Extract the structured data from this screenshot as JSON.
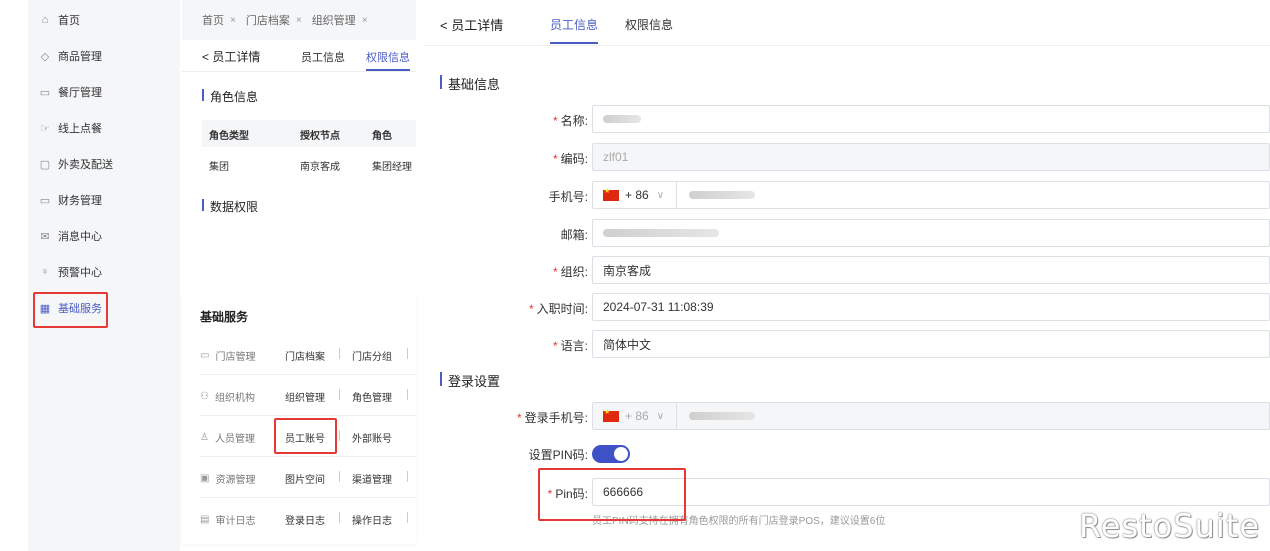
{
  "sidebar": {
    "items": [
      {
        "label": "首页",
        "icon": "home-icon",
        "glyph": "⌂"
      },
      {
        "label": "商品管理",
        "icon": "cube-icon",
        "glyph": "◇"
      },
      {
        "label": "餐厅管理",
        "icon": "store-icon",
        "glyph": "▭"
      },
      {
        "label": "线上点餐",
        "icon": "hand-icon",
        "glyph": "☞"
      },
      {
        "label": "外卖及配送",
        "icon": "bag-icon",
        "glyph": "▢"
      },
      {
        "label": "财务管理",
        "icon": "wallet-icon",
        "glyph": "▭"
      },
      {
        "label": "消息中心",
        "icon": "mail-icon",
        "glyph": "✉"
      },
      {
        "label": "预警中心",
        "icon": "bulb-icon",
        "glyph": "♀"
      },
      {
        "label": "基础服务",
        "icon": "grid-icon",
        "glyph": "▦"
      }
    ],
    "active_index": 8
  },
  "mid": {
    "tabs": [
      {
        "label": "首页"
      },
      {
        "label": "门店档案"
      },
      {
        "label": "组织管理"
      }
    ],
    "tab_close": "×",
    "back_label": "员工详情",
    "back_arrow": "<",
    "tab_info": "员工信息",
    "tab_perm": "权限信息",
    "role_section": "角色信息",
    "table_headers": [
      "角色类型",
      "授权节点",
      "角色"
    ],
    "table_row": [
      "集团",
      "南京客成",
      "集团经理"
    ],
    "data_section": "数据权限"
  },
  "base_services": {
    "title": "基础服务",
    "rows": [
      {
        "cat": "门店管理",
        "icon": "store-icon",
        "glyph": "▭",
        "a": "门店档案",
        "b": "门店分组"
      },
      {
        "cat": "组织机构",
        "icon": "org-icon",
        "glyph": "⚇",
        "a": "组织管理",
        "b": "角色管理"
      },
      {
        "cat": "人员管理",
        "icon": "people-icon",
        "glyph": "♙",
        "a": "员工账号",
        "b": "外部账号"
      },
      {
        "cat": "资源管理",
        "icon": "image-icon",
        "glyph": "▣",
        "a": "图片空间",
        "b": "渠道管理"
      },
      {
        "cat": "审计日志",
        "icon": "log-icon",
        "glyph": "▤",
        "a": "登录日志",
        "b": "操作日志"
      }
    ]
  },
  "detail": {
    "back_arrow": "<",
    "back_label": "员工详情",
    "tab_info": "员工信息",
    "tab_perm": "权限信息",
    "basic_section": "基础信息",
    "login_section": "登录设置",
    "required_mark": "*",
    "fields": {
      "name_label": "名称:",
      "code_label": "编码:",
      "code_value": "zlf01",
      "phone_label": "手机号:",
      "phone_prefix": "+ 86",
      "email_label": "邮箱:",
      "org_label": "组织:",
      "org_value": "南京客成",
      "join_label": "入职时间:",
      "join_value": "2024-07-31 11:08:39",
      "lang_label": "语言:",
      "lang_value": "简体中文",
      "login_phone_label": "登录手机号:",
      "login_phone_prefix": "+ 86",
      "pin_toggle_label": "设置PIN码:",
      "pin_label": "Pin码:",
      "pin_value": "666666",
      "pin_hint": "员工PIN码支持在拥有角色权限的所有门店登录POS，建议设置6位"
    },
    "pin_enabled": true
  },
  "watermark": "RestoSuite",
  "colors": {
    "accent": "#4b5cc4",
    "highlight": "#e53935",
    "required": "#e53935",
    "toggle": "#3f51c7"
  }
}
